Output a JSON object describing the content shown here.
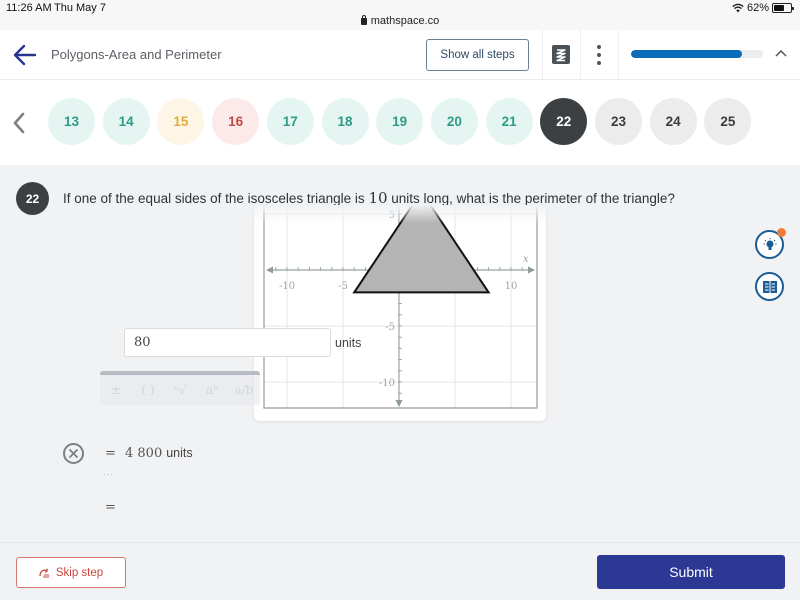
{
  "status_bar": {
    "time": "11:26 AM",
    "date": "Thu May 7",
    "url": "mathspace.co",
    "battery_percent": "62%",
    "battery_level": 0.62
  },
  "header": {
    "title": "Polygons-Area and Perimeter",
    "show_all_steps_label": "Show all steps",
    "progress_fraction": 0.84,
    "icons": {
      "back": "arrow-left-icon",
      "app": "zigzag-logo-icon",
      "more": "kebab-menu-icon",
      "collapse": "chevron-up-icon"
    }
  },
  "question_nav": {
    "prev_icon": "chevron-left-icon",
    "questions": [
      {
        "number": "13",
        "status": "correct"
      },
      {
        "number": "14",
        "status": "correct"
      },
      {
        "number": "15",
        "status": "partial"
      },
      {
        "number": "16",
        "status": "wrong"
      },
      {
        "number": "17",
        "status": "correct"
      },
      {
        "number": "18",
        "status": "correct"
      },
      {
        "number": "19",
        "status": "correct"
      },
      {
        "number": "20",
        "status": "correct"
      },
      {
        "number": "21",
        "status": "correct"
      },
      {
        "number": "22",
        "status": "current"
      },
      {
        "number": "23",
        "status": "todo"
      },
      {
        "number": "24",
        "status": "todo"
      },
      {
        "number": "25",
        "status": "todo"
      }
    ]
  },
  "question": {
    "number": "22",
    "text_before": "If one of the equal sides of the isosceles triangle is ",
    "math_value": "10",
    "text_after": " units long, what is the perimeter of the triangle?"
  },
  "graph": {
    "x_axis_label": "x",
    "x_ticks": [
      {
        "value": -10,
        "label": "-10"
      },
      {
        "value": -5,
        "label": "-5"
      },
      {
        "value": 5,
        "label": "5"
      },
      {
        "value": 10,
        "label": "10"
      }
    ],
    "y_ticks": [
      {
        "value": 5,
        "label": "5"
      },
      {
        "value": -5,
        "label": "-5"
      },
      {
        "value": -10,
        "label": "-10"
      }
    ],
    "x_range": [
      -12,
      12
    ],
    "y_range": [
      -12,
      6
    ],
    "triangle": [
      [
        -4,
        -2
      ],
      [
        8,
        -2
      ],
      [
        2,
        7
      ]
    ],
    "triangle_fill": "#b4b4b4",
    "triangle_stroke": "#111111"
  },
  "side_tools": {
    "hint_icon": "lightbulb-icon",
    "worked_examples_icon": "book-icon",
    "hint_notification": true
  },
  "previous_step": {
    "status_icon": "incorrect-x-icon",
    "equals": "=",
    "value": "4 800",
    "units": "units",
    "ellipsis": "..."
  },
  "current_step": {
    "equals": "=",
    "input_value": "80",
    "units": "units"
  },
  "math_keyboard": {
    "keys": [
      "±",
      "( )",
      "ⁿ√",
      "aᵇ",
      "a/b"
    ]
  },
  "footer": {
    "skip_label": "Skip step",
    "submit_label": "Submit"
  },
  "colors": {
    "brand_primary": "#2d3794",
    "progress": "#0c6cb8",
    "skip": "#c9473c",
    "correct": "#2f9a88",
    "partial": "#e2ab3b",
    "wrong": "#c24a45"
  }
}
